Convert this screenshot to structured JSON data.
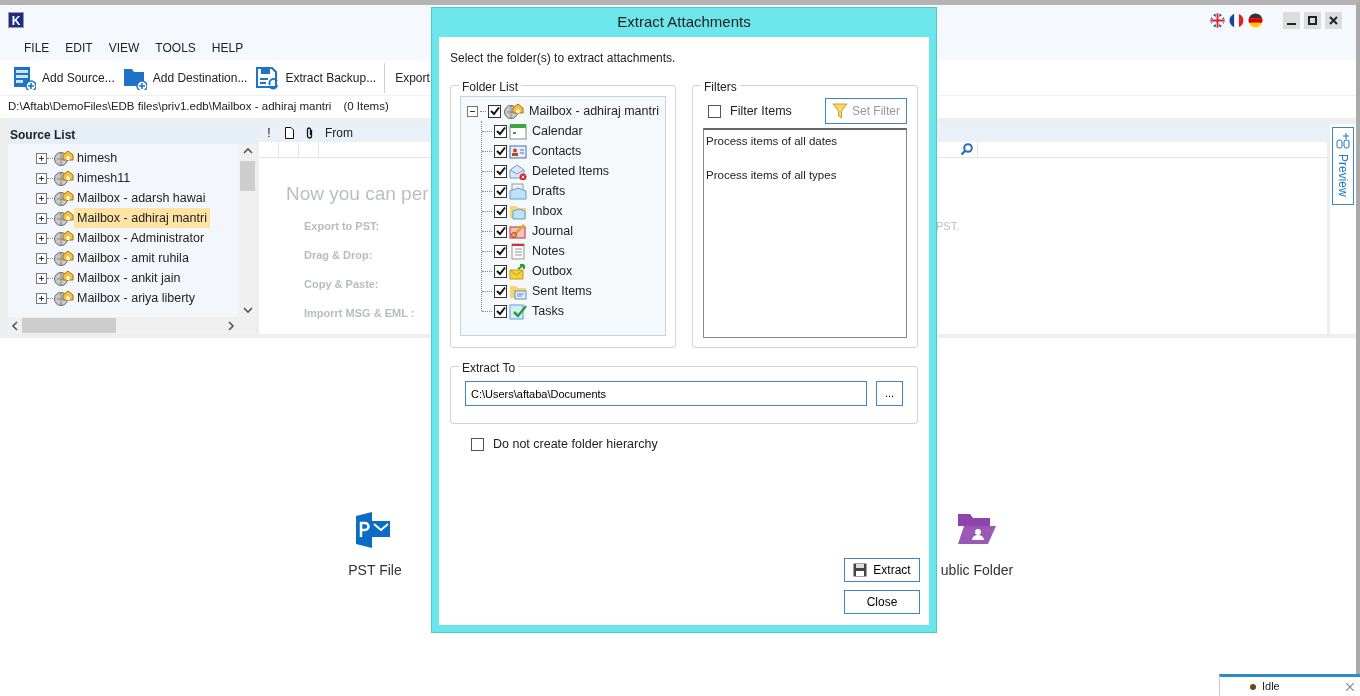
{
  "window": {
    "logo": "K"
  },
  "menu": [
    "FILE",
    "EDIT",
    "VIEW",
    "TOOLS",
    "HELP"
  ],
  "toolbar": [
    {
      "label": "Add Source...",
      "kind": "source"
    },
    {
      "label": "Add Destination...",
      "kind": "destination"
    },
    {
      "label": "Extract Backup...",
      "kind": "backup"
    },
    {
      "label": "Export",
      "kind": "plain"
    }
  ],
  "path": {
    "location": "D:\\Aftab\\DemoFiles\\EDB files\\priv1.edb\\Mailbox - adhiraj mantri",
    "count": "(0 Items)"
  },
  "source_list": {
    "title": "Source List",
    "items": [
      {
        "label": "himesh",
        "selected": false
      },
      {
        "label": "himesh11",
        "selected": false
      },
      {
        "label": "Mailbox - adarsh hawai",
        "selected": false
      },
      {
        "label": "Mailbox - adhiraj mantri",
        "selected": true
      },
      {
        "label": "Mailbox - Administrator",
        "selected": false
      },
      {
        "label": "Mailbox - amit ruhila",
        "selected": false
      },
      {
        "label": "Mailbox - ankit jain",
        "selected": false
      },
      {
        "label": "Mailbox - ariya liberty",
        "selected": false
      }
    ]
  },
  "message_list": {
    "columns": [
      "!",
      "From"
    ]
  },
  "welcome": {
    "heading": "Now you can per",
    "features": [
      "Export to PST:",
      "Drag & Drop:",
      "Copy & Paste:",
      "Imporrt MSG & EML :"
    ],
    "trailing": "PST."
  },
  "preview_tab": "Preview",
  "destinations": [
    {
      "label": "PST File",
      "kind": "pst"
    },
    {
      "label": "ublic Folder",
      "kind": "public"
    }
  ],
  "dialog": {
    "title": "Extract Attachments",
    "instruction": "Select the folder(s) to extract attachments.",
    "folder_list": {
      "legend": "Folder List",
      "root": {
        "label": "Mailbox - adhiraj mantri",
        "checked": true,
        "expanded": true,
        "children": [
          {
            "label": "Calendar",
            "checked": true,
            "kind": "calendar"
          },
          {
            "label": "Contacts",
            "checked": true,
            "kind": "contacts"
          },
          {
            "label": "Deleted Items",
            "checked": true,
            "kind": "deleted"
          },
          {
            "label": "Drafts",
            "checked": true,
            "kind": "drafts"
          },
          {
            "label": "Inbox",
            "checked": true,
            "kind": "inbox"
          },
          {
            "label": "Journal",
            "checked": true,
            "kind": "journal"
          },
          {
            "label": "Notes",
            "checked": true,
            "kind": "notes"
          },
          {
            "label": "Outbox",
            "checked": true,
            "kind": "outbox"
          },
          {
            "label": "Sent Items",
            "checked": true,
            "kind": "sent"
          },
          {
            "label": "Tasks",
            "checked": true,
            "kind": "tasks"
          }
        ]
      }
    },
    "filters": {
      "legend": "Filters",
      "filter_items": {
        "label": "Filter Items",
        "checked": false
      },
      "set_filter": {
        "label": "Set Filter",
        "disabled": true
      },
      "summary": [
        "Process items of all dates",
        "Process items of all types"
      ]
    },
    "extract_to": {
      "legend": "Extract To",
      "value": "C:\\Users\\aftaba\\Documents",
      "browse": "..."
    },
    "no_hierarchy": {
      "label": "Do not create folder hierarchy",
      "checked": false
    },
    "buttons": [
      {
        "label": "Extract",
        "kind": "extract"
      },
      {
        "label": "Close",
        "kind": "close"
      }
    ]
  },
  "status": {
    "label": "Idle"
  }
}
